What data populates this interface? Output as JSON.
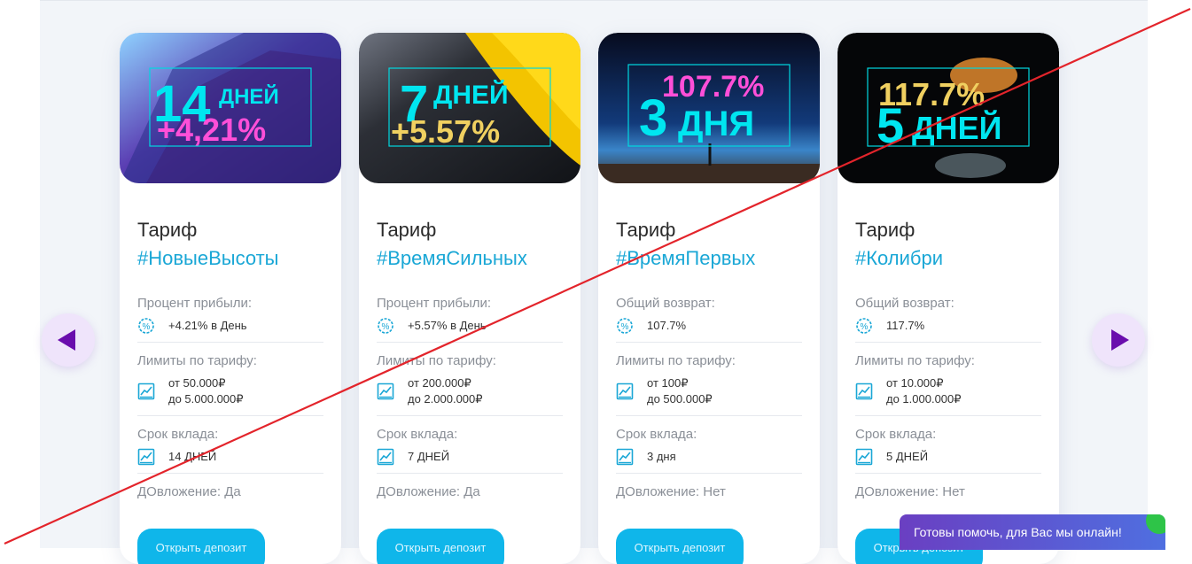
{
  "cards": [
    {
      "banner": {
        "big": "14",
        "word": "ДНЕЙ",
        "line2": "+4,21%"
      },
      "tariff_word": "Тариф",
      "name": "#НовыеВысоты",
      "rate_label": "Процент прибыли:",
      "rate_value": "+4.21% в День",
      "limits_label": "Лимиты по тарифу:",
      "limit_from": "от 50.000₽",
      "limit_to": "до 5.000.000₽",
      "term_label": "Срок вклада:",
      "term_value": "14 ДНЕЙ",
      "reinvest": "ДОвложение: Да",
      "cta_label": "Открыть депозит"
    },
    {
      "banner": {
        "big": "7",
        "word": "ДНЕЙ",
        "line2": "+5.57%"
      },
      "tariff_word": "Тариф",
      "name": "#ВремяСильных",
      "rate_label": "Процент прибыли:",
      "rate_value": "+5.57% в День",
      "limits_label": "Лимиты по тарифу:",
      "limit_from": "от 200.000₽",
      "limit_to": "до 2.000.000₽",
      "term_label": "Срок вклада:",
      "term_value": "7 ДНЕЙ",
      "reinvest": "ДОвложение: Да",
      "cta_label": "Открыть депозит"
    },
    {
      "banner": {
        "big": "3",
        "word": "ДНЯ",
        "line2": "107.7%"
      },
      "tariff_word": "Тариф",
      "name": "#ВремяПервых",
      "rate_label": "Общий возврат:",
      "rate_value": "107.7%",
      "limits_label": "Лимиты по тарифу:",
      "limit_from": "от 100₽",
      "limit_to": "до 500.000₽",
      "term_label": "Срок вклада:",
      "term_value": "3 дня",
      "reinvest": "ДОвложение: Нет",
      "cta_label": "Открыть депозит"
    },
    {
      "banner": {
        "big": "5",
        "word": "ДНЕЙ",
        "line2": "117.7%"
      },
      "tariff_word": "Тариф",
      "name": "#Колибри",
      "rate_label": "Общий возврат:",
      "rate_value": "117.7%",
      "limits_label": "Лимиты по тарифу:",
      "limit_from": "от 10.000₽",
      "limit_to": "до 1.000.000₽",
      "term_label": "Срок вклада:",
      "term_value": "5 ДНЕЙ",
      "reinvest": "ДОвложение: Нет",
      "cta_label": "Открыть депозит"
    }
  ],
  "chat": {
    "label": "Готовы помочь, для Вас мы онлайн!"
  },
  "icons": {
    "percent": "percent-badge-icon",
    "limits": "chart-growth-icon",
    "term": "chart-growth-icon",
    "prev": "triangle-left-icon",
    "next": "triangle-right-icon"
  },
  "colors": {
    "accent": "#1aa7d6",
    "button": "#0fb6ea",
    "arrow": "#6a0dad",
    "chat_start": "#6a3fc2",
    "chat_end": "#4f6fe0",
    "online": "#2ec448",
    "overlay_line": "#e3242b"
  }
}
